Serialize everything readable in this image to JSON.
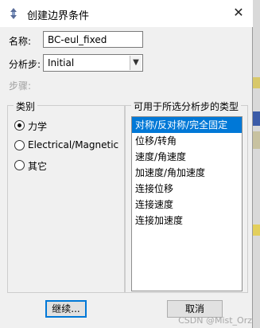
{
  "dialog": {
    "title": "创建边界条件",
    "name_label": "名称:",
    "name_value": "BC-eul_fixed",
    "step_label": "分析步:",
    "step_value": "Initial",
    "procedure_label": "步骤:",
    "category": {
      "title": "类别",
      "options": [
        {
          "label": "力学",
          "selected": true
        },
        {
          "label": "Electrical/Magnetic",
          "selected": false
        },
        {
          "label": "其它",
          "selected": false
        }
      ]
    },
    "types": {
      "title": "可用于所选分析步的类型",
      "items": [
        {
          "label": "对称/反对称/完全固定",
          "selected": true
        },
        {
          "label": "位移/转角",
          "selected": false
        },
        {
          "label": "速度/角速度",
          "selected": false
        },
        {
          "label": "加速度/角加速度",
          "selected": false
        },
        {
          "label": "连接位移",
          "selected": false
        },
        {
          "label": "连接速度",
          "selected": false
        },
        {
          "label": "连接加速度",
          "selected": false
        }
      ]
    },
    "continue_label": "继续...",
    "cancel_label": "取消"
  },
  "watermark": "CSDN @Mist_Orz",
  "icons": {
    "app": "abaqus-app-icon",
    "close": "close-icon",
    "dropdown": "chevron-down-icon"
  },
  "colors": {
    "selection": "#0078d7",
    "dialog_bg": "#f0f0f0"
  }
}
